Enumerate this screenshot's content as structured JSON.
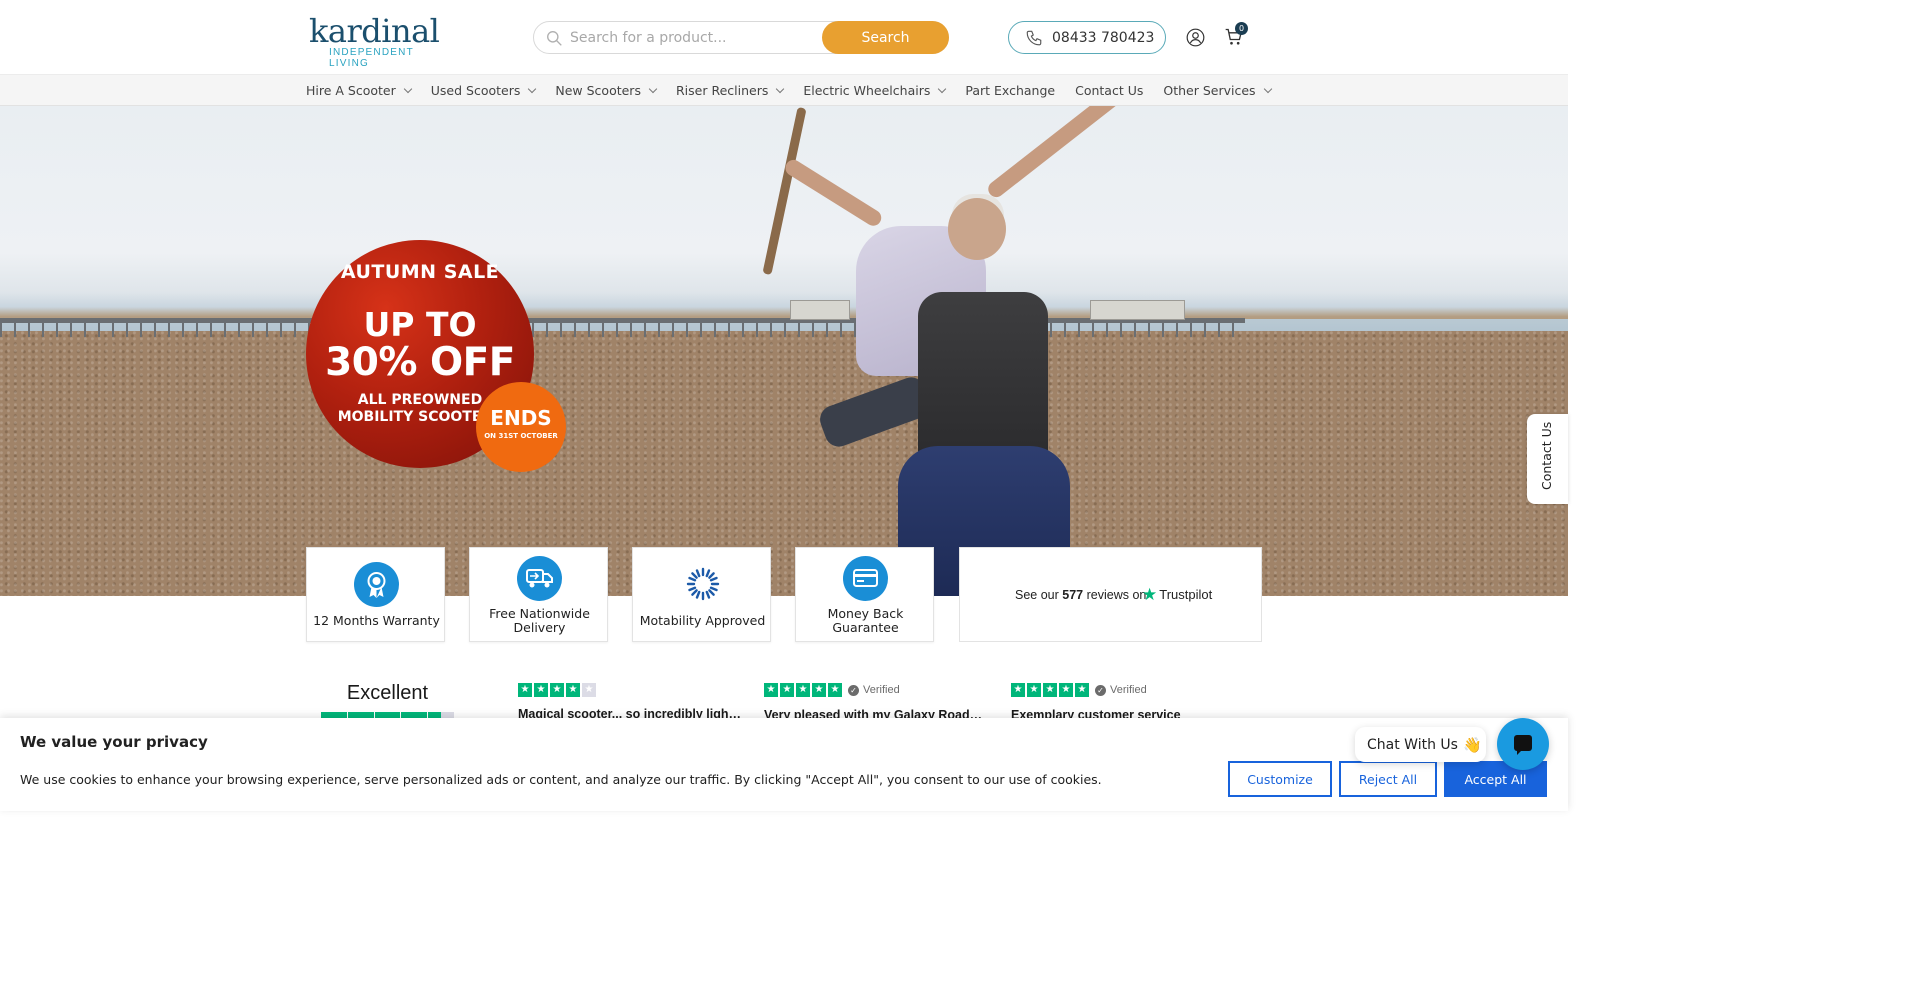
{
  "header": {
    "logo_main": "kardinal",
    "logo_sub": "INDEPENDENT LIVING",
    "search_placeholder": "Search for a product...",
    "search_button": "Search",
    "phone": "08433 780423",
    "cart_count": "0"
  },
  "nav": {
    "items": [
      {
        "label": "Hire A Scooter",
        "dropdown": true
      },
      {
        "label": "Used Scooters",
        "dropdown": true
      },
      {
        "label": "New Scooters",
        "dropdown": true
      },
      {
        "label": "Riser Recliners",
        "dropdown": true
      },
      {
        "label": "Electric Wheelchairs",
        "dropdown": true
      },
      {
        "label": "Part Exchange",
        "dropdown": false
      },
      {
        "label": "Contact Us",
        "dropdown": false
      },
      {
        "label": "Other Services",
        "dropdown": true
      }
    ]
  },
  "hero": {
    "badge_line1": "AUTUMN SALE",
    "badge_line2": "UP TO",
    "badge_line3": "30% OFF",
    "badge_line4": "ALL PREOWNED MOBILITY SCOOTERS",
    "ends_line1": "ENDS",
    "ends_line2": "ON 31ST OCTOBER"
  },
  "contact_tab": "Contact Us",
  "features": [
    {
      "label": "12 Months Warranty",
      "icon": "award-ribbon-icon"
    },
    {
      "label": "Free Nationwide Delivery",
      "icon": "delivery-truck-icon"
    },
    {
      "label": "Motability Approved",
      "icon": "motability-logo-icon"
    },
    {
      "label": "Money Back Guarantee",
      "icon": "credit-card-icon"
    }
  ],
  "trustpilot": {
    "prefix": "See our",
    "count": "577",
    "suffix": "reviews on",
    "brand": "Trustpilot"
  },
  "reviews_summary": {
    "rating_word": "Excellent",
    "stars": 4.5
  },
  "reviews": [
    {
      "stars": 4,
      "verified": "",
      "title": "Magical scooter... so incredibly light ..."
    },
    {
      "stars": 5,
      "verified": "Verified",
      "title": "Very pleased with my Galaxy Roadsta..."
    },
    {
      "stars": 5,
      "verified": "Verified",
      "title": "Exemplary customer service"
    }
  ],
  "cookie": {
    "title": "We value your privacy",
    "text": "We use cookies to enhance your browsing experience, serve personalized ads or content, and analyze our traffic. By clicking \"Accept All\", you consent to our use of cookies.",
    "customize": "Customize",
    "reject": "Reject All",
    "accept": "Accept All"
  },
  "chat": {
    "label": "Chat With Us",
    "emoji": "👋"
  },
  "colors": {
    "brand_navy": "#1b4f6d",
    "brand_teal": "#2aa3c0",
    "search_orange": "#e8a030",
    "feature_blue": "#1a8ed6",
    "trustpilot_green": "#00b67a",
    "cookie_blue": "#1863dc",
    "sale_red": "#b0200f",
    "ends_orange": "#f06a10"
  }
}
